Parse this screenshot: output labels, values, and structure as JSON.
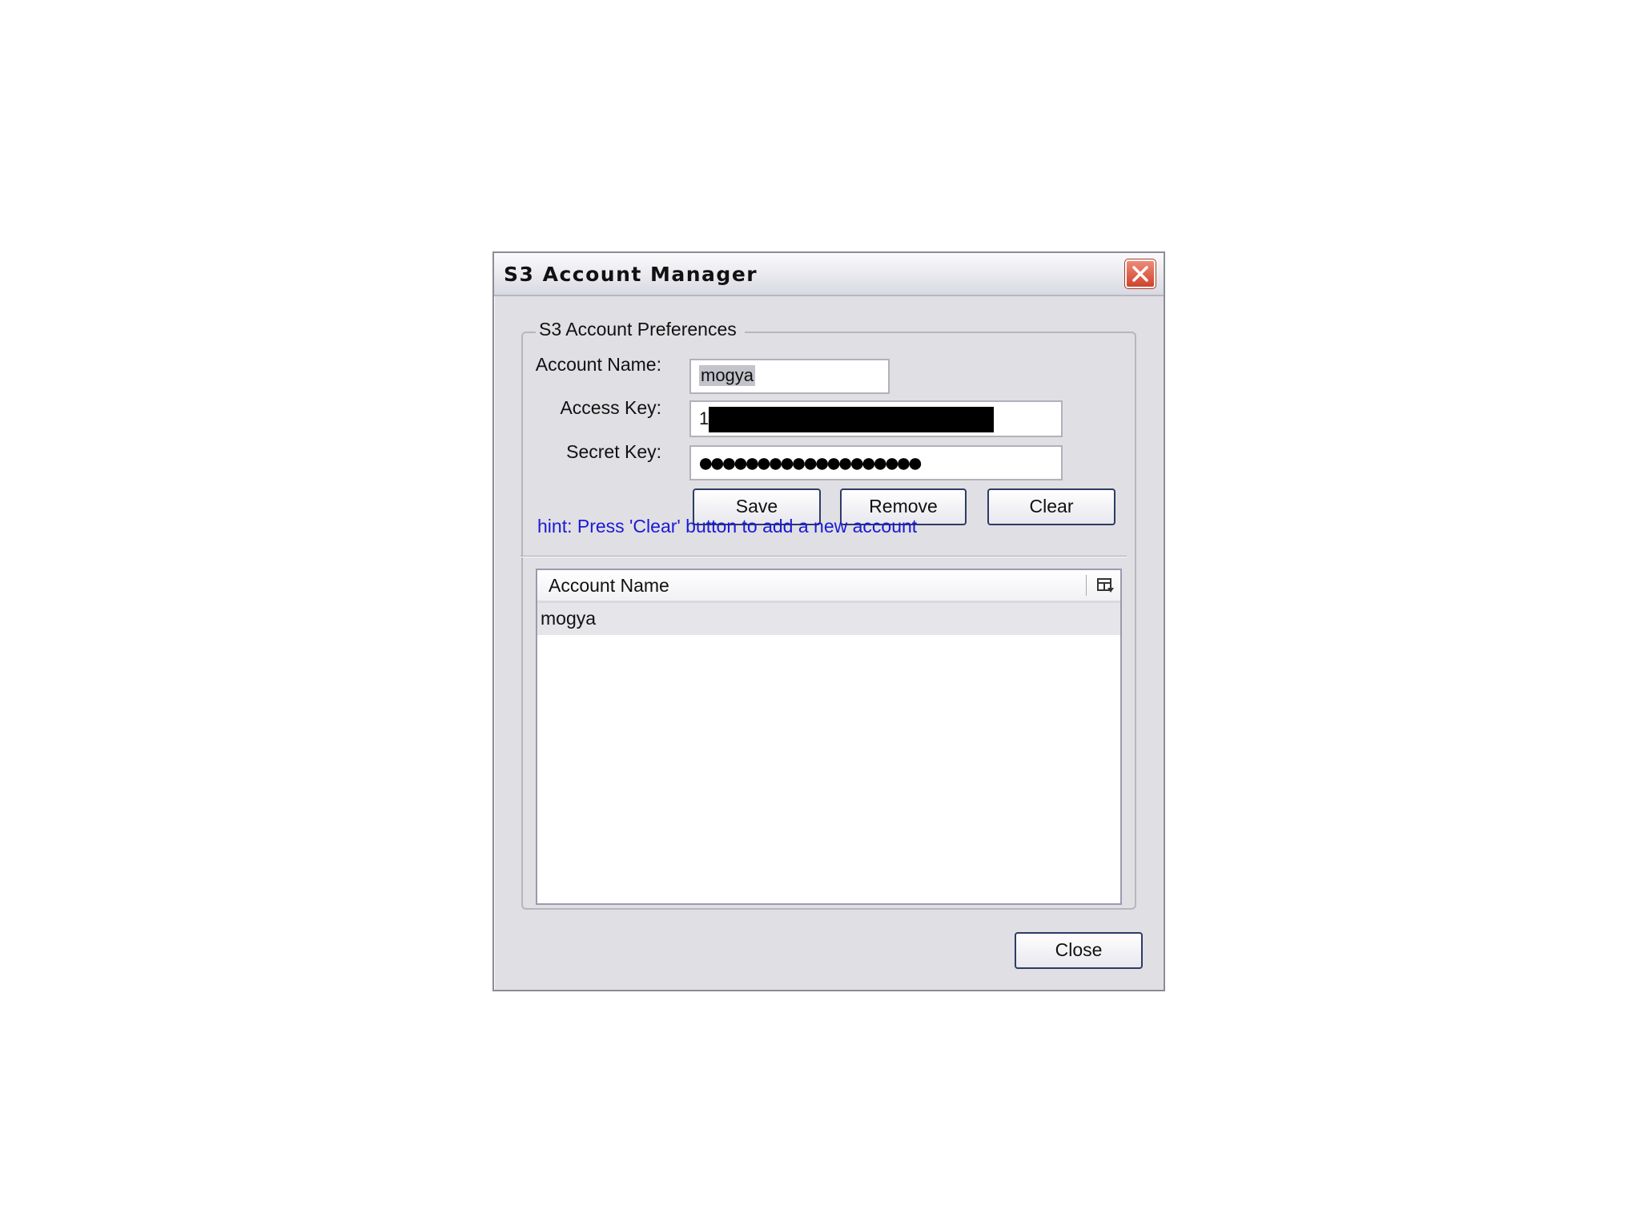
{
  "window": {
    "title": "S3 Account Manager"
  },
  "preferences": {
    "group_title": "S3 Account Preferences",
    "account_name_label": "Account Name:",
    "account_name_value": "mogya",
    "access_key_label": "Access Key:",
    "access_key_value_visible": "1",
    "secret_key_label": "Secret Key:",
    "secret_key_masked": "●●●●●●●●●●●●●●●●●●●",
    "save_label": "Save",
    "remove_label": "Remove",
    "clear_label": "Clear",
    "hint": "hint: Press 'Clear' button to add a new account"
  },
  "accounts_table": {
    "column_header": "Account Name",
    "rows": [
      "mogya"
    ]
  },
  "footer": {
    "close_label": "Close"
  },
  "icons": {
    "window_close": "close-icon",
    "column_menu": "column-chooser-icon"
  },
  "colors": {
    "dialog_bg": "#e0dfe3",
    "hint_text": "#1a1ad6",
    "close_button": "#d0432d",
    "selected_row": "#e6e6ea"
  }
}
